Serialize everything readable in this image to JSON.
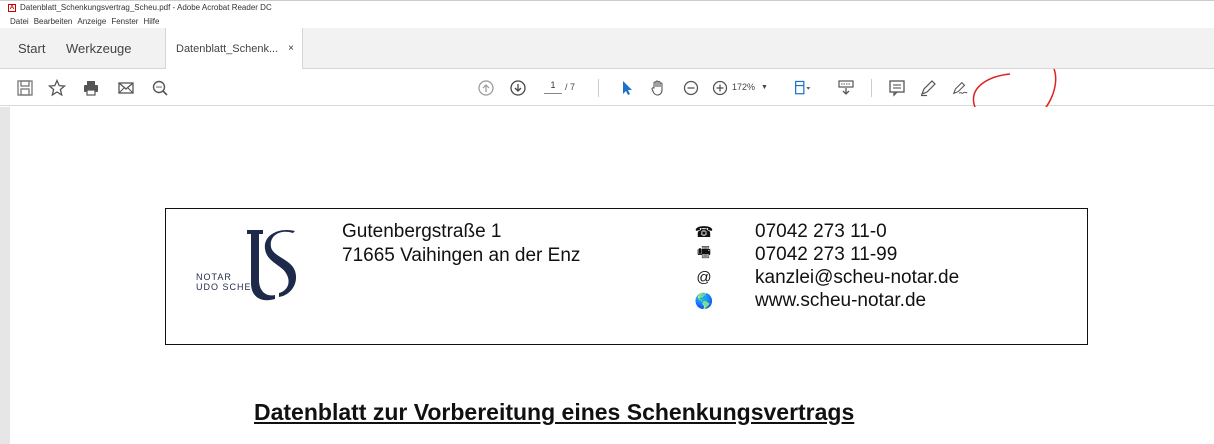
{
  "window": {
    "title": "Datenblatt_Schenkungsvertrag_Scheu.pdf - Adobe Acrobat Reader DC",
    "app_icon": "acrobat-icon"
  },
  "menu": [
    "Datei",
    "Bearbeiten",
    "Anzeige",
    "Fenster",
    "Hilfe"
  ],
  "tabs": {
    "start": "Start",
    "werkzeuge": "Werkzeuge",
    "document": "Datenblatt_Schenk...",
    "close": "×"
  },
  "toolbar": {
    "page_current": "1",
    "page_total": "/ 7",
    "zoom": "172%",
    "icons": [
      "save-icon",
      "star-icon",
      "print-icon",
      "email-icon",
      "search-zoom-icon",
      "page-up-icon",
      "page-down-icon",
      "select-cursor-icon",
      "hand-icon",
      "zoom-out-icon",
      "zoom-in-icon",
      "fit-page-icon",
      "keyboard-scroll-icon",
      "comment-icon",
      "highlight-pen-icon",
      "sign-icon"
    ]
  },
  "annotation": {
    "color": "#e0201e"
  },
  "document": {
    "logo_letters": "US",
    "logo_line1": "NOTAR",
    "logo_line2": "UDO SCHEU",
    "address_line1": "Gutenbergstraße 1",
    "address_line2": "71665 Vaihingen an der Enz",
    "contacts": [
      {
        "icon": "☎",
        "text": "07042 273 11-0"
      },
      {
        "icon": "🖷",
        "text": "07042 273 11-99"
      },
      {
        "icon": "@",
        "text": "kanzlei@scheu-notar.de"
      },
      {
        "icon": "🌎",
        "text": "www.scheu-notar.de"
      }
    ],
    "title": "Datenblatt zur Vorbereitung eines Schenkungsvertrags"
  }
}
